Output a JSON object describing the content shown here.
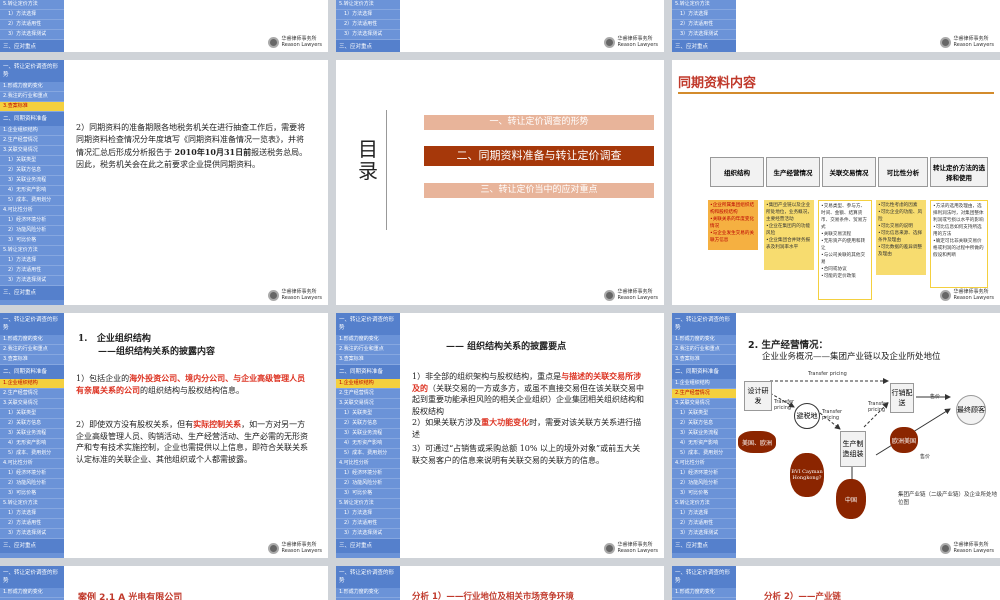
{
  "sidebar": {
    "header": "一、转让定价调查的形势",
    "items_a": [
      "1.形成力度的变化",
      "2.我注的行业和重点",
      "3.查案标准"
    ],
    "header2": "二、同期资料准备",
    "items_b": [
      "1.企业组织结构",
      "2.生产经营情况",
      "3.关联交易情况"
    ],
    "items_b_sub": [
      "1）关联类型",
      "2）关联方信息",
      "3）关联业务流程",
      "4）无形资产影响",
      "5）成本、费用划分"
    ],
    "items_c": [
      "4.可比性分析"
    ],
    "items_c_sub": [
      "1）经济环境分析",
      "2）功能风险分析",
      "3）可比价格"
    ],
    "items_d": [
      "5.转让定价方法"
    ],
    "items_d_sub": [
      "1）方法选择",
      "2）方法适用性",
      "3）方法选择测试"
    ],
    "header3": "三、应对重点"
  },
  "logo": {
    "cn": "华睿律师事务所",
    "en": "Reason Lawyers"
  },
  "top_partial": {
    "items": [
      "5.转让定价方法",
      "1）方法选择",
      "2）方法适用性",
      "3）方法选择测试"
    ],
    "footer": "三、应对重点"
  },
  "slide_text": {
    "p1": "2）同期资料的准备期限各地税务机关在进行抽查工作后，需要将同期资料检查情况分年度填写《同期资料准备情况一览表》，并将情况汇总后形成分析报告于 ",
    "p1_red": "2010年10月31日前",
    "p1_end": "报送税务总局。因此，税务机关会在此之前要求企业提供同期资料。"
  },
  "toc": {
    "title": "目录",
    "items": [
      "一、转让定价调查的形势",
      "二、同期资料准备与转让定价调查",
      "三、转让定价当中的应对重点"
    ]
  },
  "contemp": {
    "title": "同期资料内容",
    "steps": [
      "组织结构",
      "生产经营情况",
      "关联交易情况",
      "可比性分析",
      "转让定价方法的选择和使用"
    ],
    "cols": [
      [
        "•企业所属集团组织结构和股权结构",
        "•关联关系的年度变化情况",
        "•与企业发生交易的关联方信息"
      ],
      [
        "•集团产业链以及企业所处地位，业务概况，主要经营活动",
        "•企业在集团内的功能风险",
        "•企业集团合并财务报表及利润率水平"
      ],
      [
        "•交易类型、参与方、时间、金额、结算货币、交易条件、贸易方式",
        "•关联交易流程",
        "•无形资产的使用和转让",
        "•与公司关联的其他交易",
        "•合同或协议",
        "•可能的定价政策"
      ],
      [
        "•可比性考虑的因素",
        "•可比企业的功能、风险",
        "•可比交易的说明",
        "•可比信息来源、选择条件及理由",
        "•可比数据的差异调整及理由"
      ],
      [
        "•方法的选用及理由，选择利润法时，对集团整体利润或亏损以水平的影响",
        "•可比信息如何支持所选用的方法",
        "•确定可比非关联交易价格或利润的过程中所做的假设和判断"
      ]
    ]
  },
  "org": {
    "num": "1.",
    "title": "企业组织结构",
    "subtitle": "——组织结构关系的披露内容",
    "p1_a": "1）包括企业的",
    "p1_red": "海外投资公司、境内分公司、与企业高级管理人员有亲属关系的公司",
    "p1_b": "的组织结构与股权结构信息。",
    "p2_a": "2）即使双方没有股权关系，但有",
    "p2_red": "实际控制关系",
    "p2_b": "，如一方对另一方企业高级管理人员、购销活动、生产经营活动、生产必需的无形资产和专有技术实施控制，企业也需提供以上信息，即符合关联关系认定标准的关联企业、其他组织或个人都需披露。"
  },
  "org2": {
    "title": "—— 组织结构关系的披露要点",
    "p1_a": "1）非全部的组织架构与股权结构，重点是",
    "p1_red": "与描述的关联交易所涉及的",
    "p1_b": "（关联交易的一方或多方，或虽不直接交易但在该关联交易中起到重要功能承担风险的相关企业组织）企业集团相关组织结构和股权结构",
    "p2_a": "2）如果关联方涉及",
    "p2_red": "重大功能变化",
    "p2_b": "时，需要对该关联方关系进行描述",
    "p3": "3）可通过“占销售或采购总额 10% 以上的境外对象”或前五大关联交易客户的信息来说明有关联交易的关联方的信息。"
  },
  "biz": {
    "title": "2. 生产经营情况：",
    "subtitle": "企业业务概况——集团产业链以及企业所处地位",
    "nodes": [
      "设计研发",
      "避税地",
      "生产制造组装",
      "行销配送",
      "最终顾客",
      "美国、欧洲",
      "BVI Cayman Hongkong?",
      "欧洲美国",
      "中国"
    ],
    "arrows": [
      "Transfer pricing",
      "Transfer pricing",
      "Transfer pricing",
      "Transfer pricing",
      "售价",
      "售价"
    ],
    "caption": "集团产业链（二级产业链）及企业所处地位图"
  },
  "bottom": {
    "case": "案例 2.1    A 光电有限公司",
    "analysis1": "分析 1）——行业地位及相关市场竞争环境",
    "analysis2": "分析 2）——产业链"
  }
}
